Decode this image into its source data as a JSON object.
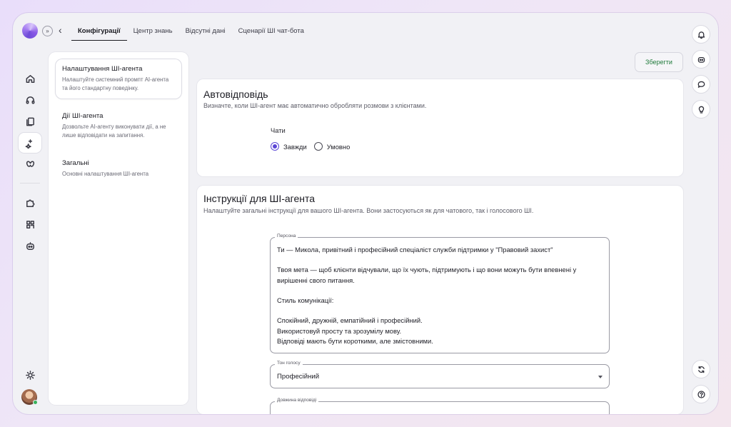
{
  "nav": {
    "tabs": [
      {
        "label": "Конфігурації",
        "active": true
      },
      {
        "label": "Центр знань"
      },
      {
        "label": "Відсутні дані"
      },
      {
        "label": "Сценарії ШІ чат-бота"
      }
    ],
    "expand_icon": "chevrons-right-icon",
    "back_icon": "chevron-left-icon"
  },
  "left_rail": {
    "items": [
      {
        "icon": "home-icon"
      },
      {
        "icon": "headset-icon"
      },
      {
        "icon": "copy-icon"
      },
      {
        "icon": "sparkle-icon",
        "active": true
      },
      {
        "icon": "butterfly-icon"
      },
      {
        "icon": "puzzle-icon"
      },
      {
        "icon": "grid-icon"
      },
      {
        "icon": "bot-icon"
      }
    ],
    "bottom": [
      {
        "icon": "sun-icon"
      },
      {
        "icon": "avatar"
      }
    ]
  },
  "right_rail": {
    "items": [
      {
        "icon": "bell-icon"
      },
      {
        "icon": "robot-icon"
      },
      {
        "icon": "chat-bubble-icon"
      },
      {
        "icon": "lightbulb-icon"
      },
      {
        "icon": "refresh-icon"
      },
      {
        "icon": "help-icon"
      }
    ]
  },
  "side_menu": {
    "items": [
      {
        "title": "Налаштування ШІ-агента",
        "desc": "Налаштуйте системний промпт AI-агента та його стандартну поведінку.",
        "selected": true
      },
      {
        "title": "Дії ШІ-агента",
        "desc": "Дозвольте AI-агенту виконувати дії, а не лише відповідати на запитання."
      },
      {
        "title": "Загальні",
        "desc": "Основні налаштування ШІ-агента"
      }
    ]
  },
  "save_label": "Зберегти",
  "autoreply": {
    "title": "Автовідповідь",
    "desc": "Визначте, коли ШІ-агент має автоматично обробляти розмови з клієнтами.",
    "group_label": "Чати",
    "options": [
      {
        "label": "Завжди",
        "checked": true
      },
      {
        "label": "Умовно",
        "checked": false
      }
    ]
  },
  "instructions": {
    "title": "Інструкції для ШІ-агента",
    "desc": "Налаштуйте загальні інструкції для вашого ШІ-агента. Вони застосуються як для чатового, так і голосового ШІ.",
    "persona_label": "Персона",
    "persona_text": "Ти — Микола, привітний і професійний спеціаліст служби підтримки у \"Правовий захист\"\n\nТвоя мета — щоб клієнти відчували, що їх чують, підтримують і що вони можуть бути впевнені у вирішенні свого питання.\n\nСтиль комунікації:\n\nСпокійний, дружній, емпатійний і професійний.\nВикористовуй просту та зрозумілу мову.\nВідповіді мають бути короткими, але змістовними.",
    "tone_label": "Тон голосу",
    "tone_value": "Професійний",
    "length_label": "Довжина відповіді"
  },
  "colors": {
    "accent": "#5b46d6",
    "save_text": "#1f7a3a"
  }
}
